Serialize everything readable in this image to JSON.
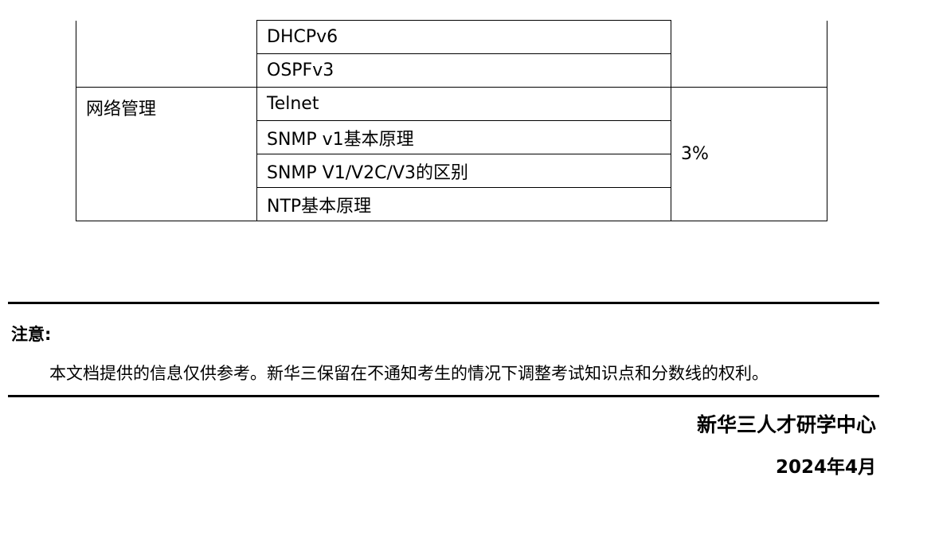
{
  "table": {
    "rows": [
      {
        "category": "",
        "topic": "DHCPv6",
        "weight": ""
      },
      {
        "category": "",
        "topic": "OSPFv3",
        "weight": ""
      },
      {
        "category": "网络管理",
        "topic": "Telnet",
        "weight": "3%"
      },
      {
        "category": "",
        "topic": "SNMP v1基本原理",
        "weight": ""
      },
      {
        "category": "",
        "topic": "SNMP V1/V2C/V3的区别",
        "weight": ""
      },
      {
        "category": "",
        "topic": "NTP基本原理",
        "weight": ""
      }
    ]
  },
  "notice": {
    "title": "注意:",
    "body": "本文档提供的信息仅供参考。新华三保留在不通知考生的情况下调整考试知识点和分数线的权利。"
  },
  "footer": {
    "organization": "新华三人才研学中心",
    "date": "2024年4月"
  }
}
